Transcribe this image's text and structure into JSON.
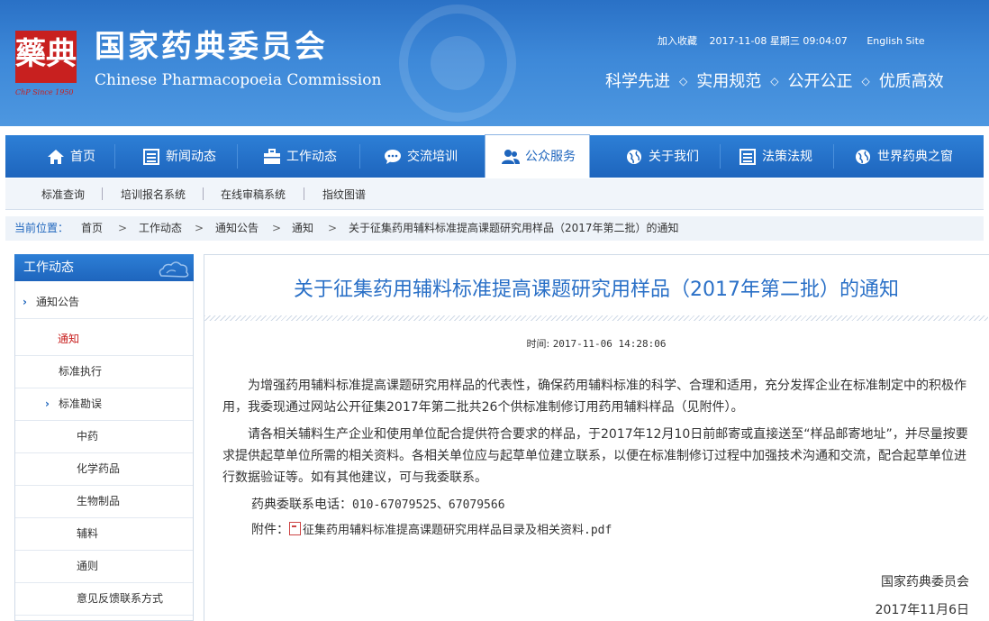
{
  "header": {
    "seal_text": "藥典",
    "seal_since": "ChP Since 1950",
    "brand_cn": "国家药典委员会",
    "brand_en": "Chinese Pharmacopoeia Commission",
    "favorite": "加入收藏",
    "datetime": "2017-11-08 星期三 09:04:07",
    "english_site": "English Site",
    "slogans": [
      "科学先进",
      "实用规范",
      "公开公正",
      "优质高效"
    ]
  },
  "nav": {
    "items": [
      {
        "label": "首页",
        "icon": "home-icon"
      },
      {
        "label": "新闻动态",
        "icon": "news-icon"
      },
      {
        "label": "工作动态",
        "icon": "briefcase-icon"
      },
      {
        "label": "交流培训",
        "icon": "chat-icon"
      },
      {
        "label": "公众服务",
        "icon": "users-icon",
        "active": true
      },
      {
        "label": "关于我们",
        "icon": "globe-icon"
      },
      {
        "label": "法策法规",
        "icon": "document-list-icon"
      },
      {
        "label": "世界药典之窗",
        "icon": "globe-icon"
      }
    ]
  },
  "subnav": [
    "标准查询",
    "培训报名系统",
    "在线审稿系统",
    "指纹图谱"
  ],
  "breadcrumb": {
    "label": "当前位置：",
    "items": [
      "首页",
      "工作动态",
      "通知公告",
      "通知",
      "关于征集药用辅料标准提高课题研究用样品（2017年第二批）的通知"
    ]
  },
  "sidebar": {
    "title": "工作动态",
    "items": [
      {
        "label": "通知公告",
        "level": 0,
        "expand": true
      },
      {
        "label": "通知",
        "level": 1,
        "current": true
      },
      {
        "label": "标准执行",
        "level": 1
      },
      {
        "label": "标准勘误",
        "level": 1,
        "expand": true
      },
      {
        "label": "中药",
        "level": 2
      },
      {
        "label": "化学药品",
        "level": 2
      },
      {
        "label": "生物制品",
        "level": 2
      },
      {
        "label": "辅料",
        "level": 2
      },
      {
        "label": "通则",
        "level": 2
      },
      {
        "label": "意见反馈联系方式",
        "level": 2
      }
    ]
  },
  "article": {
    "title": "关于征集药用辅料标准提高课题研究用样品（2017年第二批）的通知",
    "time_label": "时间:",
    "time_value": "2017-11-06 14:28:06",
    "para1": "为增强药用辅料标准提高课题研究用样品的代表性，确保药用辅料标准的科学、合理和适用，充分发挥企业在标准制定中的积极作用，我委现通过网站公开征集2017年第二批共26个供标准制修订用药用辅料样品（见附件）。",
    "para2": "请各相关辅料生产企业和使用单位配合提供符合要求的样品，于2017年12月10日前邮寄或直接送至“样品邮寄地址”，并尽量按要求提供起草单位所需的相关资料。各相关单位应与起草单位建立联系，以便在标准制修订过程中加强技术沟通和交流，配合起草单位进行数据验证等。如有其他建议，可与我委联系。",
    "contact_label": "药典委联系电话：",
    "contact_value": "010-67079525、67079566",
    "attach_label": "附件：",
    "attach_link": "征集药用辅料标准提高课题研究用样品目录及相关资料.pdf",
    "signature": "国家药典委员会",
    "sign_date": "2017年11月6日"
  }
}
